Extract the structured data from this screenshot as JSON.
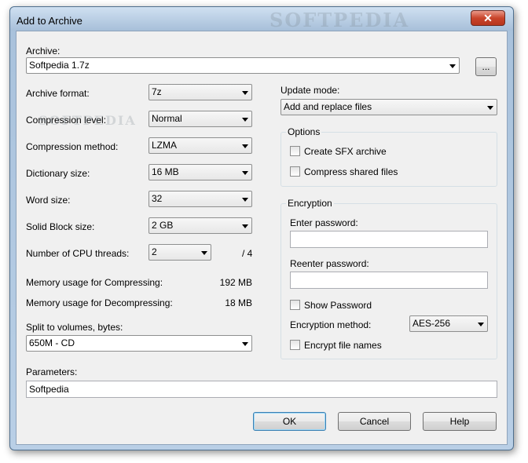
{
  "window": {
    "title": "Add to Archive",
    "close_glyph": "✕"
  },
  "watermark": {
    "title_text": "SOFTPEDIA",
    "body_text": "SOFTPEDIA"
  },
  "archive": {
    "label": "Archive:",
    "value": "Softpedia 1.7z",
    "browse_label": "..."
  },
  "left": {
    "archive_format": {
      "label": "Archive format:",
      "value": "7z"
    },
    "compression_level": {
      "label": "Compression level:",
      "value": "Normal"
    },
    "compression_method": {
      "label": "Compression method:",
      "value": "LZMA"
    },
    "dictionary_size": {
      "label": "Dictionary size:",
      "value": "16 MB"
    },
    "word_size": {
      "label": "Word size:",
      "value": "32"
    },
    "solid_block_size": {
      "label": "Solid Block size:",
      "value": "2 GB"
    },
    "cpu_threads": {
      "label": "Number of CPU threads:",
      "value": "2",
      "max": "/ 4"
    },
    "mem_compress": {
      "label": "Memory usage for Compressing:",
      "value": "192 MB"
    },
    "mem_decompress": {
      "label": "Memory usage for Decompressing:",
      "value": "18 MB"
    },
    "split": {
      "label": "Split to volumes, bytes:",
      "value": "650M - CD"
    }
  },
  "right": {
    "update_mode": {
      "label": "Update mode:",
      "value": "Add and replace files"
    },
    "options": {
      "title": "Options",
      "sfx_label": "Create SFX archive",
      "shared_label": "Compress shared files"
    },
    "encryption": {
      "title": "Encryption",
      "enter_password_label": "Enter password:",
      "enter_password_value": "",
      "reenter_password_label": "Reenter password:",
      "reenter_password_value": "",
      "show_password_label": "Show Password",
      "method_label": "Encryption method:",
      "method_value": "AES-256",
      "encrypt_names_label": "Encrypt file names"
    }
  },
  "parameters": {
    "label": "Parameters:",
    "value": "Softpedia"
  },
  "buttons": {
    "ok": "OK",
    "cancel": "Cancel",
    "help": "Help"
  }
}
